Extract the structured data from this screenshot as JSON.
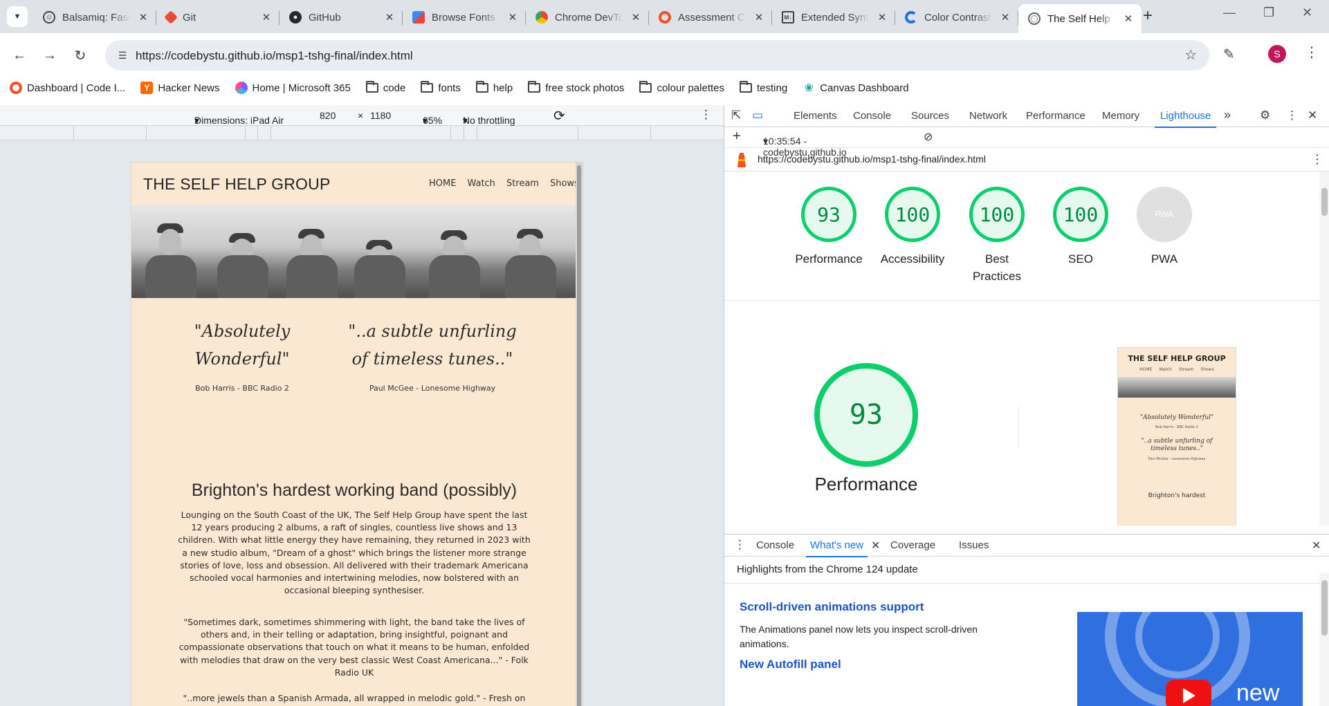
{
  "browser": {
    "tabs": [
      {
        "title": "Balsamiq: Fast",
        "icon": "smiley-icon",
        "color": "#444444"
      },
      {
        "title": "Git",
        "icon": "git-icon",
        "color": "#e84d31"
      },
      {
        "title": "GitHub",
        "icon": "github-icon",
        "color": "#24292f"
      },
      {
        "title": "Browse Fonts",
        "icon": "google-fonts-icon",
        "color": "#4285f4"
      },
      {
        "title": "Chrome DevTools",
        "icon": "chrome-icon",
        "color": "#34a853"
      },
      {
        "title": "Assessment C",
        "icon": "code-institute-icon",
        "color": "#f4511e"
      },
      {
        "title": "Extended Syntax",
        "icon": "markdown-icon",
        "color": "#444444"
      },
      {
        "title": "Color Contrast",
        "icon": "contrast-icon",
        "color": "#1a73e8"
      },
      {
        "title": "The Self Help",
        "icon": "globe-icon",
        "color": "#5f6368",
        "active": true
      }
    ],
    "new_tab": "+",
    "url": "https://codebystu.github.io/msp1-tshg-final/index.html",
    "avatar_letter": "S",
    "bookmarks": [
      {
        "label": "Dashboard | Code I...",
        "icon": "code-institute-icon"
      },
      {
        "label": "Hacker News",
        "icon": "y-icon"
      },
      {
        "label": "Home | Microsoft 365",
        "icon": "m365-icon"
      },
      {
        "label": "code",
        "icon": "folder-icon"
      },
      {
        "label": "fonts",
        "icon": "folder-icon"
      },
      {
        "label": "help",
        "icon": "folder-icon"
      },
      {
        "label": "free stock photos",
        "icon": "folder-icon"
      },
      {
        "label": "colour palettes",
        "icon": "folder-icon"
      },
      {
        "label": "testing",
        "icon": "folder-icon"
      },
      {
        "label": "Canvas Dashboard",
        "icon": "canvas-icon"
      }
    ]
  },
  "device_toolbar": {
    "dimensions": "Dimensions: iPad Air",
    "width": "820",
    "times": "×",
    "height": "1180",
    "zoom": "65%",
    "throttling": "No throttling"
  },
  "site": {
    "title": "THE SELF HELP GROUP",
    "nav": [
      "HOME",
      "Watch",
      "Stream",
      "Shows"
    ],
    "quote1": "\"Absolutely Wonderful\"",
    "quote1_source": "Bob Harris - BBC Radio 2",
    "quote2": "\"..a subtle unfurling of timeless tunes..\"",
    "quote2_source": "Paul McGee - Lonesome Highway",
    "heading": "Brighton's hardest working band (possibly)",
    "paragraph1": "Lounging on the South Coast of the UK, The Self Help Group have spent the last 12 years producing 2 albums, a raft of singles, countless live shows and 13 children. With what little energy they have remaining, they returned in 2023 with a new studio album, \"Dream of a ghost\" which brings the listener more strange stories of love, loss and obsession. All delivered with their trademark Americana schooled vocal harmonies and intertwining melodies, now bolstered with an occasional bleeping synthesiser.",
    "paragraph2": "\"Sometimes dark, sometimes shimmering with light, the band take the lives of others and, in their telling or adaptation, bring insightful, poignant and compassionate observations that touch on what it means to be human, enfolded with melodies that draw on the very best classic West Coast Americana...\" - Folk Radio UK",
    "paragraph3": "\"..more jewels than a Spanish Armada, all wrapped in melodic gold.\" - Fresh on The"
  },
  "devtools": {
    "tabs": [
      "Elements",
      "Console",
      "Sources",
      "Network",
      "Performance",
      "Memory",
      "Lighthouse"
    ],
    "active_tab": "Lighthouse",
    "more": "»",
    "report_time": "10:35:54 - codebystu.github.io",
    "report_url": "https://codebystu.github.io/msp1-tshg-final/index.html",
    "scores": [
      {
        "label": "Performance",
        "value": "93"
      },
      {
        "label": "Accessibility",
        "value": "100"
      },
      {
        "label": "Best Practices",
        "value": "100"
      },
      {
        "label": "SEO",
        "value": "100"
      },
      {
        "label": "PWA",
        "value": "PWA"
      }
    ],
    "performance_score": "93",
    "performance_label": "Performance",
    "thumbnail": {
      "title": "THE SELF HELP GROUP",
      "nav": "HOME Watch Stream Shows",
      "quote1": "\"Absolutely Wonderful\"",
      "quote1_source": "Bob Harris - BBC Radio 2",
      "quote2": "\"..a subtle unfurling of timeless tunes..\"",
      "quote2_source": "Paul McGee - Lonesome Highway",
      "heading": "Brighton's hardest"
    }
  },
  "drawer": {
    "tabs": [
      "Console",
      "What's new",
      "Coverage",
      "Issues"
    ],
    "active_tab": "What's new",
    "subtitle": "Highlights from the Chrome 124 update",
    "item1_title": "Scroll-driven animations support",
    "item1_text": "The Animations panel now lets you inspect scroll-driven animations.",
    "item2_title": "New Autofill panel",
    "banner_text": "new"
  }
}
